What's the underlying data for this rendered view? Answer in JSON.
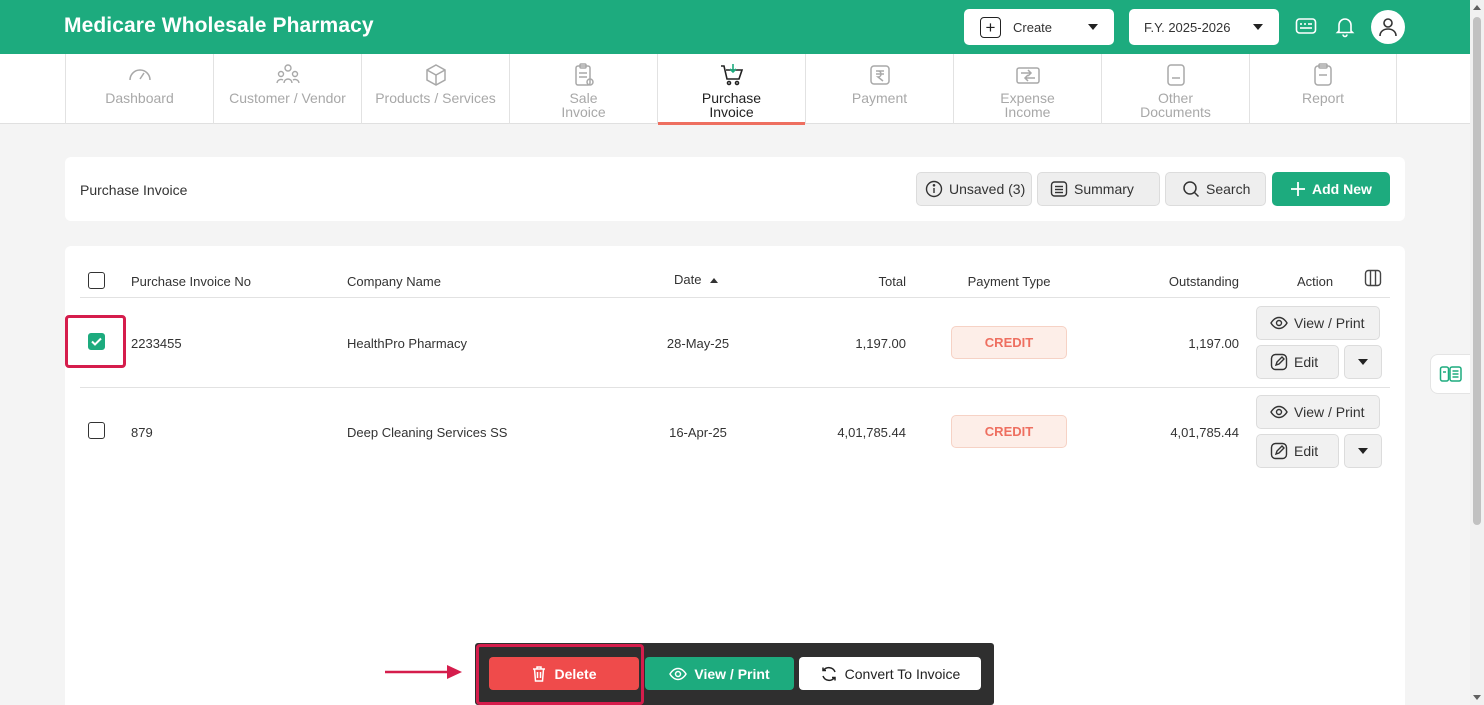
{
  "app": {
    "title": "Medicare Wholesale Pharmacy"
  },
  "header": {
    "create_label": "Create",
    "fiscal_year": "F.Y. 2025-2026",
    "icons": [
      "keyboard-icon",
      "bell-icon",
      "user-avatar-icon"
    ]
  },
  "nav": {
    "tabs": [
      {
        "label": "Dashboard",
        "icon": "gauge-icon"
      },
      {
        "label": "Customer / Vendor",
        "icon": "people-icon"
      },
      {
        "label": "Products / Services",
        "icon": "box-icon"
      },
      {
        "label": "Sale\nInvoice",
        "icon": "clipboard-icon"
      },
      {
        "label": "Purchase\nInvoice",
        "icon": "cart-icon",
        "active": true
      },
      {
        "label": "Payment",
        "icon": "rupee-doc-icon"
      },
      {
        "label": "Expense\nIncome",
        "icon": "transfer-icon"
      },
      {
        "label": "Other\nDocuments",
        "icon": "document-icon"
      },
      {
        "label": "Report",
        "icon": "report-icon"
      }
    ]
  },
  "page": {
    "title": "Purchase Invoice",
    "unsaved_label": "Unsaved (3)",
    "summary_label": "Summary",
    "search_label": "Search",
    "add_new_label": "Add New"
  },
  "table": {
    "columns": {
      "invoice_no": "Purchase Invoice No",
      "company": "Company Name",
      "date": "Date",
      "total": "Total",
      "payment_type": "Payment Type",
      "outstanding": "Outstanding",
      "action": "Action"
    },
    "sort": {
      "column": "Date",
      "direction": "ascending"
    },
    "rows": [
      {
        "invoice_no": "2233455",
        "company": "HealthPro Pharmacy",
        "date": "28-May-25",
        "total": "1,197.00",
        "payment_type": "CREDIT",
        "outstanding": "1,197.00",
        "selected": true
      },
      {
        "invoice_no": "879",
        "company": "Deep Cleaning Services SS",
        "date": "16-Apr-25",
        "total": "4,01,785.44",
        "payment_type": "CREDIT",
        "outstanding": "4,01,785.44",
        "selected": false
      }
    ],
    "row_actions": {
      "view_print": "View / Print",
      "edit": "Edit"
    }
  },
  "bulk_actions": {
    "delete": "Delete",
    "view_print": "View / Print",
    "convert": "Convert To Invoice"
  },
  "colors": {
    "brand_green": "#1dab7e",
    "credit_text": "#ee6f60",
    "delete_red": "#ef4b4b",
    "highlight": "#d51d4c"
  }
}
